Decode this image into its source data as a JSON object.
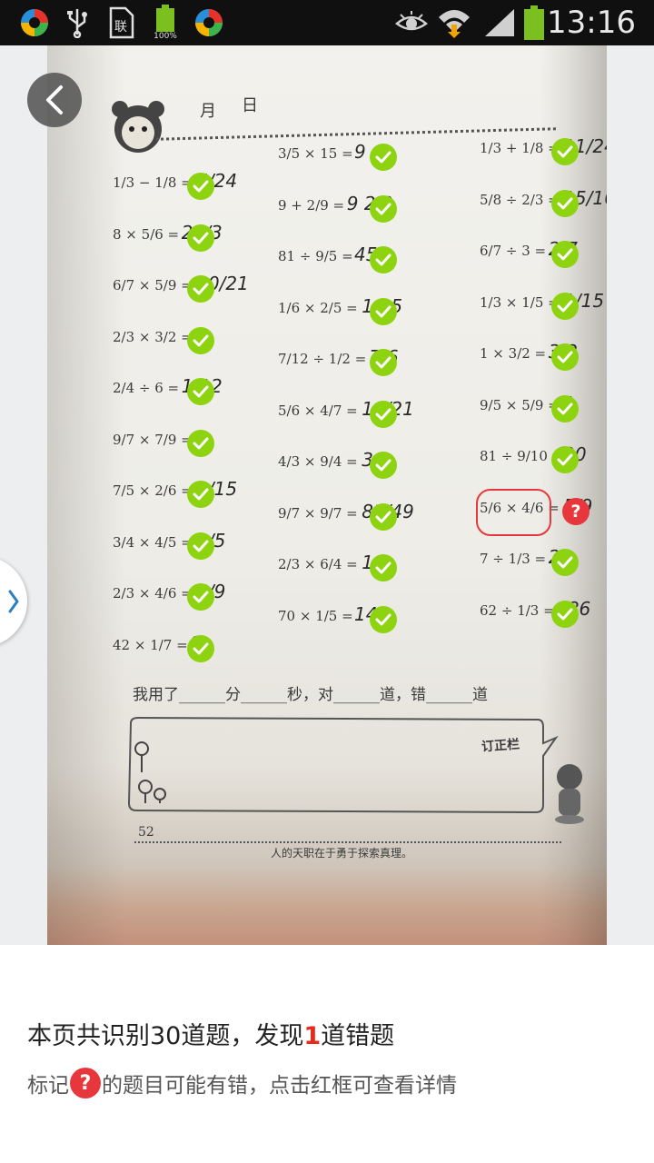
{
  "status_bar": {
    "time": "13:16",
    "battery_label": "100%",
    "icons": [
      "app-icon",
      "usb-icon",
      "sim-card-icon",
      "battery-full-icon",
      "app-icon",
      "eye-icon",
      "wifi-icon",
      "signal-icon",
      "battery-icon"
    ]
  },
  "photo": {
    "header": {
      "month": "月",
      "day": "日"
    },
    "columns": [
      {
        "problems": [
          {
            "expr": "1/3 − 1/8 =",
            "answer": "5/24",
            "status": "correct"
          },
          {
            "expr": "8 × 5/6 =",
            "answer": "20/3",
            "status": "correct"
          },
          {
            "expr": "6/7 × 5/9 =",
            "answer": "10/21",
            "status": "correct"
          },
          {
            "expr": "2/3 × 3/2 =",
            "answer": "1",
            "status": "correct"
          },
          {
            "expr": "2/4 ÷ 6 =",
            "answer": "1/12",
            "status": "correct"
          },
          {
            "expr": "9/7 × 7/9 =",
            "answer": "1",
            "status": "correct"
          },
          {
            "expr": "7/5 × 2/6 =",
            "answer": "1/15",
            "status": "correct"
          },
          {
            "expr": "3/4 × 4/5 =",
            "answer": "3/5",
            "status": "correct"
          },
          {
            "expr": "2/3 × 4/6 =",
            "answer": "4/9",
            "status": "correct"
          },
          {
            "expr": "42 × 1/7 =",
            "answer": "6",
            "status": "correct"
          }
        ]
      },
      {
        "problems": [
          {
            "expr": "3/5 × 15 =",
            "answer": "9",
            "status": "correct"
          },
          {
            "expr": "9 + 2/9 =",
            "answer": "9 2/9",
            "status": "correct"
          },
          {
            "expr": "81 ÷ 9/5 =",
            "answer": "45",
            "status": "correct"
          },
          {
            "expr": "1/6 × 2/5 =",
            "answer": "1/15",
            "status": "correct"
          },
          {
            "expr": "7/12 ÷ 1/2 =",
            "answer": "7/6",
            "status": "correct"
          },
          {
            "expr": "5/6 × 4/7 =",
            "answer": "10/21",
            "status": "correct"
          },
          {
            "expr": "4/3 × 9/4 =",
            "answer": "3",
            "status": "correct"
          },
          {
            "expr": "9/7 × 9/7 =",
            "answer": "81/49",
            "status": "correct"
          },
          {
            "expr": "2/3 × 6/4 =",
            "answer": "1",
            "status": "correct"
          },
          {
            "expr": "70 × 1/5 =",
            "answer": "14",
            "status": "correct"
          }
        ]
      },
      {
        "problems": [
          {
            "expr": "1/3 + 1/8 =",
            "answer": "11/24",
            "status": "correct"
          },
          {
            "expr": "5/8 ÷ 2/3 =",
            "answer": "15/16",
            "status": "correct"
          },
          {
            "expr": "6/7 ÷ 3 =",
            "answer": "2/7",
            "status": "correct"
          },
          {
            "expr": "1/3 × 1/5 =",
            "answer": "1/15",
            "status": "correct"
          },
          {
            "expr": "1 × 3/2 =",
            "answer": "3/2",
            "status": "correct"
          },
          {
            "expr": "9/5 × 5/9 =",
            "answer": "1",
            "status": "correct"
          },
          {
            "expr": "81 ÷ 9/10 =",
            "answer": "90",
            "status": "correct"
          },
          {
            "expr": "5/6 × 4/6 =",
            "answer": "5/9",
            "status": "uncertain"
          },
          {
            "expr": "7 ÷ 1/3 =",
            "answer": "21",
            "status": "correct"
          },
          {
            "expr": "62 ÷ 1/3 =",
            "answer": "186",
            "status": "correct"
          }
        ]
      }
    ],
    "footer_line": "我用了______分______秒，对______道，错______道",
    "correction_label": "订正栏",
    "page_number": "52",
    "motto": "人的天职在于勇于探索真理。"
  },
  "summary": {
    "title_pre": "本页共识别30道题，发现",
    "error_count": "1",
    "title_post": "道错题",
    "hint_pre": "标记",
    "hint_icon": "?",
    "hint_post": "的题目可能有错，点击红框可查看详情"
  },
  "colors": {
    "check_green": "#8dd30f",
    "question_red": "#e8373c",
    "error_text": "#e8291c",
    "status_bar": "#101010"
  }
}
